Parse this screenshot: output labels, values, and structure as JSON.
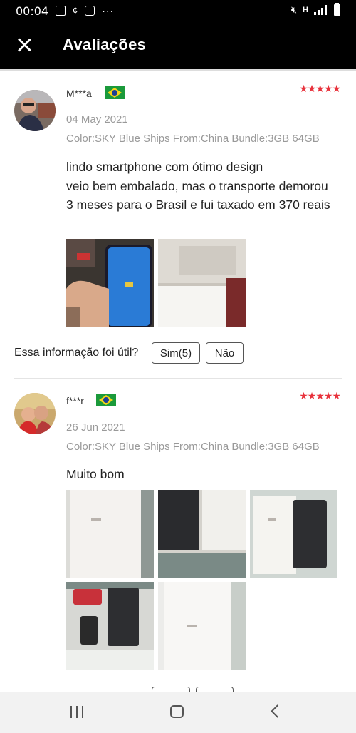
{
  "status_bar": {
    "time": "00:04",
    "icons": [
      "image-icon",
      "cast-icon",
      "settings-icon",
      "more-icon",
      "mute-icon",
      "network-icon",
      "signal-icon",
      "battery-icon"
    ],
    "network_label": "H"
  },
  "app_bar": {
    "title": "Avaliações"
  },
  "reviews": [
    {
      "username": "M***a",
      "country_flag": "brazil-flag-icon",
      "rating": 5,
      "stars_text": "★★★★★",
      "date": "04 May 2021",
      "attributes": "Color:SKY Blue Ships From:China Bundle:3GB 64GB",
      "text": "lindo smartphone com ótimo design\nveio bem embalado, mas o transporte demorou 3 meses para o Brasil e fui taxado em 370 reais",
      "photo_count": 2,
      "helpful": {
        "question": "Essa informação foi útil?",
        "yes_label": "Sim(5)",
        "no_label": "Não"
      }
    },
    {
      "username": "f***r",
      "country_flag": "brazil-flag-icon",
      "rating": 5,
      "stars_text": "★★★★★",
      "date": "26 Jun 2021",
      "attributes": "Color:SKY Blue Ships From:China Bundle:3GB 64GB",
      "text": "Muito bom",
      "photo_count": 5
    }
  ],
  "colors": {
    "star_red": "#e8323c",
    "appbar_bg": "#000000",
    "muted_text": "#999999"
  },
  "nav_bar": {
    "icons": [
      "recent-apps-icon",
      "home-icon",
      "back-icon"
    ]
  }
}
